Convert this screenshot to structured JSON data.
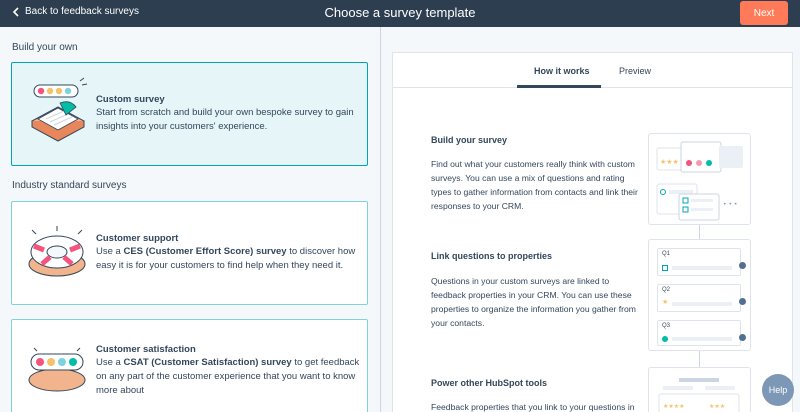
{
  "header": {
    "back_label": "Back to feedback surveys",
    "title": "Choose a survey template",
    "next_label": "Next"
  },
  "left": {
    "build_own_heading": "Build your own",
    "industry_heading": "Industry standard surveys",
    "custom": {
      "title": "Custom survey",
      "desc": "Start from scratch and build your own bespoke survey to gain insights into your customers' experience."
    },
    "support": {
      "title": "Customer support",
      "desc_pre": "Use a ",
      "desc_bold": "CES (Customer Effort Score) survey",
      "desc_post": " to discover how easy it is for your customers to find help when they need it."
    },
    "satisfaction": {
      "title": "Customer satisfaction",
      "desc_pre": "Use a ",
      "desc_bold": "CSAT (Customer Satisfaction) survey",
      "desc_post": " to get feedback on any part of the customer experience that you want to know more about"
    }
  },
  "right": {
    "tabs": [
      "How it works",
      "Preview"
    ],
    "blocks": [
      {
        "title": "Build your survey",
        "text": "Find out what your customers really think with custom surveys. You can use a mix of questions and rating types to gather information from contacts and link their responses to your CRM."
      },
      {
        "title": "Link questions to properties",
        "text": "Questions in your custom surveys are linked to feedback properties in your CRM. You can use these properties to organize the information you gather from your contacts."
      },
      {
        "title": "Power other HubSpot tools",
        "text": "Feedback properties that you link to your questions in"
      }
    ],
    "question_labels": [
      "Q1",
      "Q2",
      "Q3"
    ]
  },
  "help_label": "Help",
  "colors": {
    "header_bg": "#2d3e50",
    "accent": "#ff7a59",
    "selected_border": "#00a4bd",
    "selected_bg": "#e5f5f8",
    "help_bg": "#7c98b6"
  }
}
